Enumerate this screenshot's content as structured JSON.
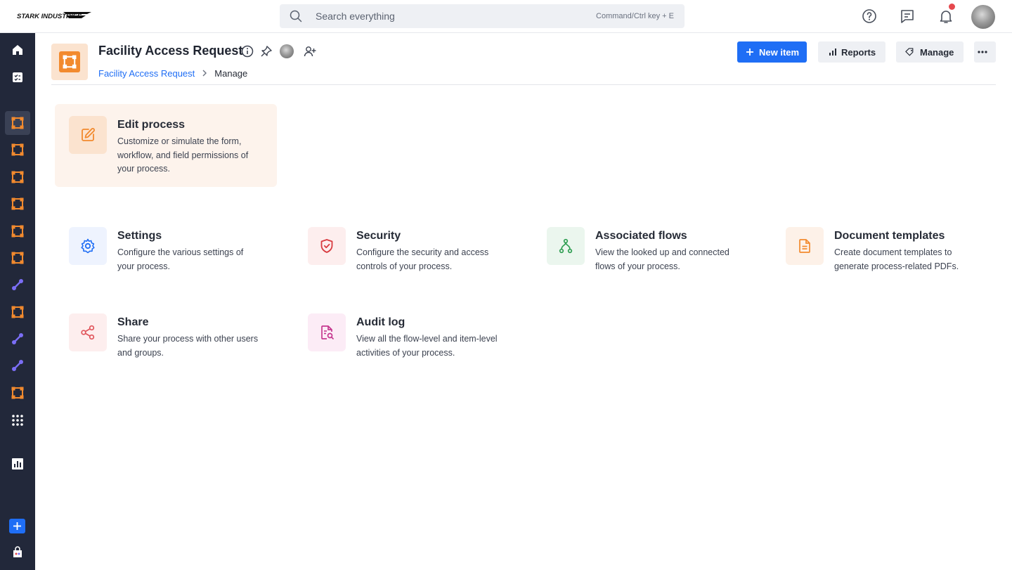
{
  "topbar": {
    "brand": "STARK INDUSTRIES",
    "search_placeholder": "Search everything",
    "search_hint": "Command/Ctrl key + E",
    "icons": [
      "help-icon",
      "chat-icon",
      "bell-icon",
      "user-avatar"
    ]
  },
  "sidebar": {
    "items": [
      "home-icon",
      "tasks-icon",
      "process-icon",
      "process-icon",
      "process-icon",
      "process-icon",
      "process-icon",
      "process-icon",
      "link-icon",
      "process-icon",
      "link-icon",
      "link-icon",
      "process-icon",
      "apps-grid-icon",
      "analytics-icon"
    ],
    "bottom": [
      "add-icon",
      "store-icon"
    ]
  },
  "header": {
    "title": "Facility Access Request",
    "breadcrumb": {
      "root": "Facility Access Request",
      "current": "Manage"
    },
    "buttons": {
      "new_item": "New item",
      "reports": "Reports",
      "manage": "Manage"
    }
  },
  "cards": {
    "edit": {
      "title": "Edit process",
      "desc": "Customize or simulate the form, workflow, and field permissions of your process."
    },
    "settings": {
      "title": "Settings",
      "desc": "Configure the various settings of your process."
    },
    "security": {
      "title": "Security",
      "desc": "Configure the security and access controls of your process."
    },
    "flows": {
      "title": "Associated flows",
      "desc": "View the looked up and connected flows of your process."
    },
    "templates": {
      "title": "Document templates",
      "desc": "Create document templates to generate process-related PDFs."
    },
    "share": {
      "title": "Share",
      "desc": "Share your process with other users and groups."
    },
    "audit": {
      "title": "Audit log",
      "desc": "View all the flow-level and item-level activities of your process."
    }
  },
  "colors": {
    "primary": "#1f6ef5",
    "sidebar": "#22283a",
    "process_orange": "#f28a2e",
    "edit_card_bg": "#fdf3ec",
    "notification_dot": "#e5484d"
  }
}
